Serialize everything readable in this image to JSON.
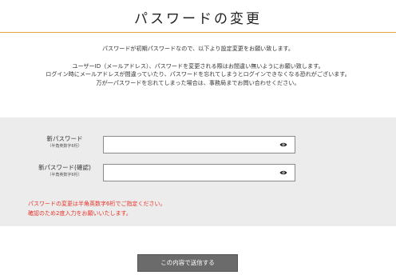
{
  "header": {
    "title": "パスワードの変更"
  },
  "intro": {
    "line1": "パスワードが初期パスワードなので、以下より設定変更をお願い致します。",
    "line2": "ユーザーID（メールアドレス）、パスワードを変更される際はお間違い無いようにお願い致します。",
    "line3": "ログイン時にメールアドレスが間違っていたり、パスワードを忘れてしまうとログインできなくなる恐れがございます。",
    "line4": "万が一パスワードを忘れてしまった場合は、事務局までお問い合わせください。"
  },
  "form": {
    "new_password": {
      "label": "新パスワード",
      "hint": "（半角英数字6桁）",
      "value": "",
      "icon": "eye-icon"
    },
    "confirm_password": {
      "label": "新パスワード(確認)",
      "hint": "（半角英数字6桁）",
      "value": "",
      "icon": "eye-icon"
    }
  },
  "notice": {
    "line1": "パスワードの変更は半角英数字6桁でご指定ください。",
    "line2": "確認のため2度入力をお願いいたします。"
  },
  "submit": {
    "label": "この内容で送信する"
  },
  "colors": {
    "accent": "#e7a33b",
    "panel": "#ececec",
    "error": "#e8332a",
    "button": "#6b6b6b"
  }
}
